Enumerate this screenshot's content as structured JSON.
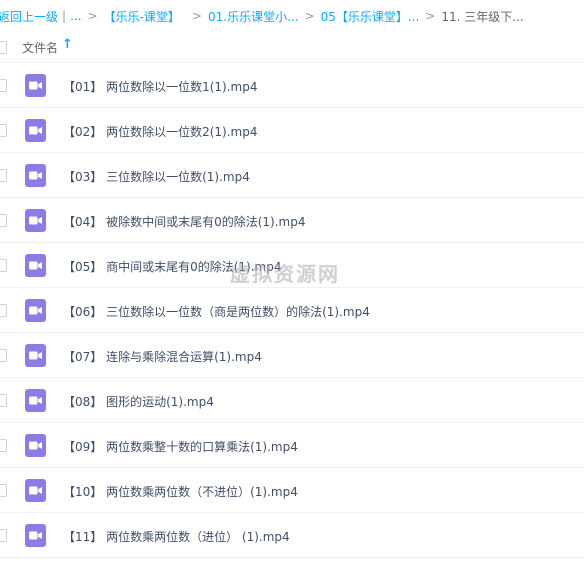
{
  "breadcrumb": {
    "back": "返回上一级",
    "sep1": "|",
    "ellipsis": "...",
    "chevron": ">",
    "crumb1": "【乐乐-课堂】",
    "crumb2": "01.乐乐课堂小...",
    "crumb3": "05【乐乐课堂】...",
    "current": "11. 三年级下..."
  },
  "list_header": {
    "name_label": "文件名",
    "sort_icon": "↑"
  },
  "files": [
    {
      "name": "【01】 两位数除以一位数1(1).mp4",
      "icon": "video-icon"
    },
    {
      "name": "【02】 两位数除以一位数2(1).mp4",
      "icon": "video-icon"
    },
    {
      "name": "【03】 三位数除以一位数(1).mp4",
      "icon": "video-icon"
    },
    {
      "name": "【04】 被除数中间或末尾有0的除法(1).mp4",
      "icon": "video-icon"
    },
    {
      "name": "【05】 商中间或末尾有0的除法(1).mp4",
      "icon": "video-icon"
    },
    {
      "name": "【06】 三位数除以一位数（商是两位数）的除法(1).mp4",
      "icon": "video-icon"
    },
    {
      "name": "【07】 连除与乘除混合运算(1).mp4",
      "icon": "video-icon"
    },
    {
      "name": "【08】 图形的运动(1).mp4",
      "icon": "video-icon"
    },
    {
      "name": "【09】 两位数乘整十数的口算乘法(1).mp4",
      "icon": "video-icon"
    },
    {
      "name": "【10】 两位数乘两位数（不进位）(1).mp4",
      "icon": "video-icon"
    },
    {
      "name": "【11】 两位数乘两位数（进位） (1).mp4",
      "icon": "video-icon"
    }
  ],
  "watermark": "虚拟资源网",
  "colors": {
    "link": "#09AAFF",
    "video_icon_bg": "#8C7CE6",
    "text": "#424e67"
  }
}
